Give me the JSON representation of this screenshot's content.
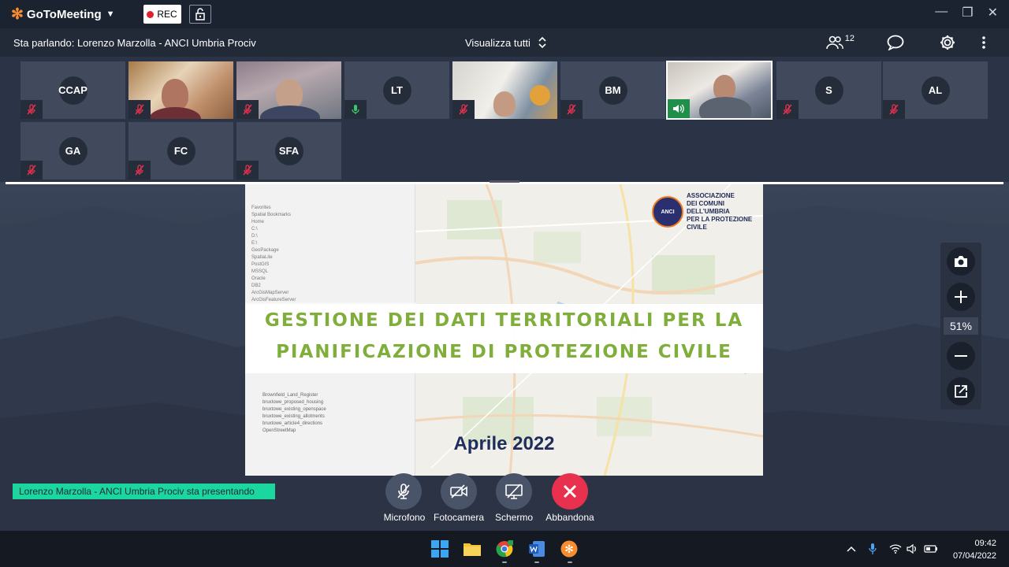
{
  "titlebar": {
    "app_name": "GoToMeeting",
    "rec_label": "REC"
  },
  "infobar": {
    "speaking": "Sta parlando: Lorenzo Marzolla - ANCI Umbria Prociv",
    "view_all": "Visualizza tutti",
    "participant_count": "12"
  },
  "tiles": [
    {
      "initials": "CCAP",
      "muted": true
    },
    {
      "initials": "",
      "muted": true,
      "video": true
    },
    {
      "initials": "",
      "muted": true,
      "video": true
    },
    {
      "initials": "LT",
      "muted": false
    },
    {
      "initials": "",
      "muted": true,
      "video": true
    },
    {
      "initials": "BM",
      "muted": true
    },
    {
      "initials": "",
      "speaking": true,
      "video": true
    },
    {
      "initials": "S",
      "muted": true
    },
    {
      "initials": "AL",
      "muted": true
    },
    {
      "initials": "GA",
      "muted": true
    },
    {
      "initials": "FC",
      "muted": true
    },
    {
      "initials": "SFA",
      "muted": true
    }
  ],
  "slide": {
    "title_line1": "GESTIONE DEI DATI TERRITORIALI PER LA",
    "title_line2": "PIANIFICAZIONE DI PROTEZIONE CIVILE",
    "date": "Aprile 2022",
    "assoc_line1": "ASSOCIAZIONE",
    "assoc_line2": "DEI COMUNI DELL'UMBRIA",
    "assoc_line3": "PER LA PROTEZIONE CIVILE",
    "assoc_logo": "ANCI",
    "browser_items": [
      "Favorites",
      "Spatial Bookmarks",
      "Home",
      "C:\\",
      "D:\\",
      "E:\\",
      "GeoPackage",
      "SpatiaLite",
      "PostGIS",
      "MSSQL",
      "Oracle",
      "DB2",
      "ArcGisMapServer",
      "ArcGisFeatureServer"
    ],
    "layer_items": [
      "Brownfield_Land_Register",
      "bruxtowe_proposed_housing",
      "bruxtowe_existing_openspace",
      "bruxtowe_existing_allotments",
      "bruxtowe_article4_directions",
      "OpenStreetMap"
    ]
  },
  "zoom": {
    "level": "51%"
  },
  "presenting": "Lorenzo Marzolla - ANCI Umbria Prociv sta presentando",
  "controls": {
    "mic": "Microfono",
    "camera": "Fotocamera",
    "screen": "Schermo",
    "leave": "Abbandona"
  },
  "taskbar": {
    "time": "09:42",
    "date": "07/04/2022"
  },
  "colors": {
    "accent_orange": "#f68d2e",
    "rec_red": "#e0202b",
    "leave_red": "#e8304f",
    "banner_green": "#1cd6a0",
    "slide_title_green": "#7fae3a",
    "mute_red": "#e8304f",
    "speak_green": "#36c96a"
  }
}
